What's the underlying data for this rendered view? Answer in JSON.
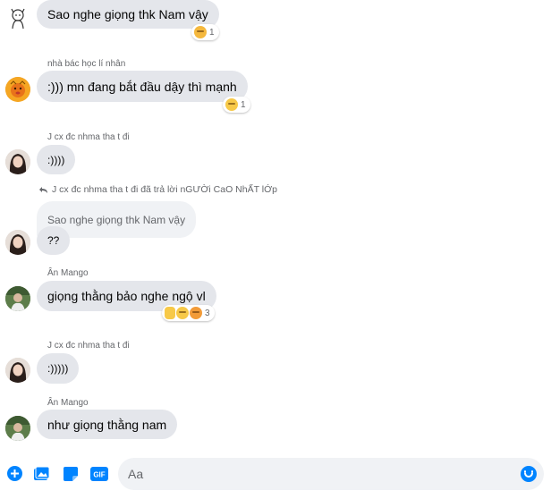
{
  "colors": {
    "accent": "#0084ff",
    "bubble": "#e4e6eb",
    "reply_bubble": "#f0f2f5",
    "meta_text": "#65676b"
  },
  "messages": [
    {
      "sender": "",
      "text": "Sao nghe giọng thk Nam vậy",
      "avatar": "cartoon-sketch-avatar",
      "reaction": {
        "emojis": [
          "crying-cat-emoji"
        ],
        "count": "1"
      }
    },
    {
      "sender": "nhà bác học lí nhân",
      "text": ":))) mn đang bắt đầu dậy thì mạnh",
      "avatar": "emoji-style-avatar",
      "reaction": {
        "emojis": [
          "sad-face-emoji"
        ],
        "count": "1"
      }
    },
    {
      "sender": "J cx đc nhma tha t đi",
      "text": ":))))",
      "avatar": "girl-photo-avatar"
    },
    {
      "reply_note": "J cx đc nhma tha t đi đã trả lời nGƯỜi CaO NhẤT lỚp",
      "quoted_text": "Sao nghe giọng thk Nam vậy",
      "text": "??",
      "avatar": "girl-photo-avatar"
    },
    {
      "sender": "Ân Mango",
      "text": "giọng thằng bảo nghe ngộ vl",
      "avatar": "green-photo-avatar",
      "reaction": {
        "emojis": [
          "thumbs-up-emoji",
          "laughing-emoji",
          "heart-eyes-cat-emoji"
        ],
        "count": "3"
      }
    },
    {
      "sender": "J cx đc nhma tha t đi",
      "text": ":)))))",
      "avatar": "girl-photo-avatar"
    },
    {
      "sender": "Ân Mango",
      "text": "như giọng thằng nam",
      "avatar": "green-photo-avatar"
    }
  ],
  "composer": {
    "placeholder": "Aa",
    "icons": [
      "add-circle-icon",
      "photo-icon",
      "sticker-icon",
      "gif-icon",
      "emoji-icon"
    ],
    "gif_label": "GIF"
  }
}
